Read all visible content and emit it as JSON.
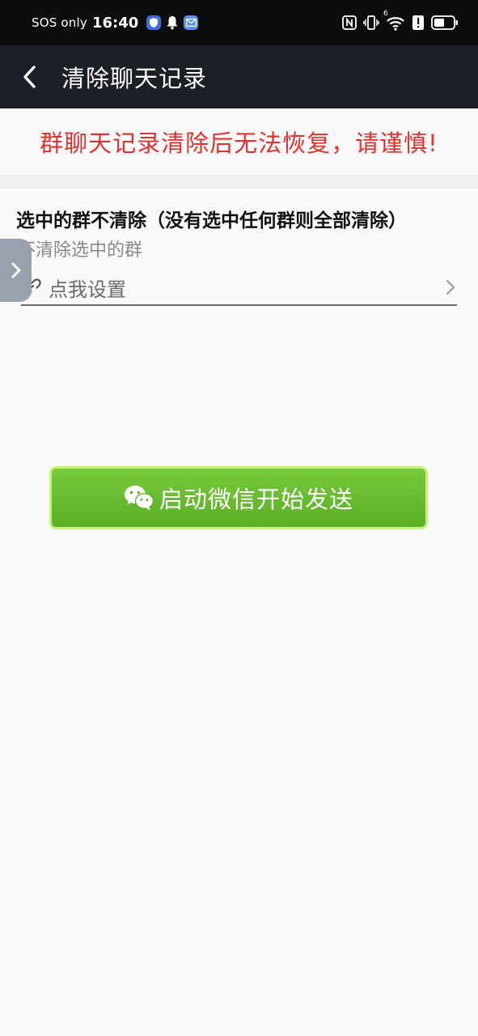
{
  "status_bar": {
    "carrier": "SOS only",
    "time": "16:40",
    "icons": [
      "shield-badge-icon",
      "bell-icon",
      "mail-badge-icon",
      "nfc-icon",
      "vibrate-icon",
      "wifi-icon",
      "alert-icon",
      "battery-icon"
    ],
    "wifi_badge": "6",
    "battery_level": 0.55
  },
  "app_bar": {
    "back_icon": "chevron-left-icon",
    "title": "清除聊天记录"
  },
  "warning": {
    "text": "群聊天记录清除后无法恢复，请谨慎!",
    "color": "#e0322e"
  },
  "setting": {
    "title": "选中的群不清除（没有选中任何群则全部清除）",
    "subtitle": "不清除选中的群",
    "link_icon": "link-icon",
    "link_label": "点我设置",
    "chevron_icon": "chevron-right-icon"
  },
  "side_tab": {
    "icon": "chevron-right-icon"
  },
  "start_button": {
    "icon": "wechat-icon",
    "label": "启动微信开始发送",
    "color": "#6abd31",
    "border_color": "#c5f27a"
  },
  "colors": {
    "status_bar_bg": "#0d0d0d",
    "app_bar_bg": "#1c1f26",
    "page_bg": "#f9f9f9"
  }
}
